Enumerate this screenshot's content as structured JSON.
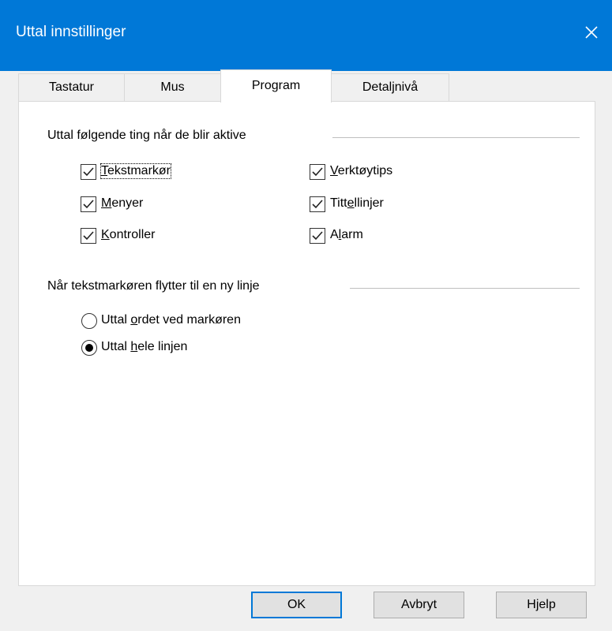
{
  "window": {
    "title": "Uttal innstillinger"
  },
  "tabs": [
    {
      "label": "Tastatur",
      "active": false
    },
    {
      "label": "Mus",
      "active": false
    },
    {
      "label": "Program",
      "active": true
    },
    {
      "label": "Detaljnivå",
      "active": false
    }
  ],
  "group1": {
    "label": "Uttal følgende ting når de blir aktive",
    "options": [
      {
        "label": "Tekstmarkør",
        "access_key": "T",
        "checked": true
      },
      {
        "label": "Menyer",
        "access_key": "M",
        "checked": true
      },
      {
        "label": "Kontroller",
        "access_key": "K",
        "checked": true
      },
      {
        "label": "Verktøytips",
        "access_key": "V",
        "checked": true
      },
      {
        "label": "Tittellinjer",
        "access_key": "e",
        "checked": true
      },
      {
        "label": "Alarm",
        "access_key": "l",
        "checked": true
      }
    ]
  },
  "group2": {
    "label": "Når tekstmarkøren flytter til en ny linje",
    "options": [
      {
        "label": "Uttal ordet ved markøren",
        "access_key": "o",
        "selected": false
      },
      {
        "label": "Uttal hele linjen",
        "access_key": "h",
        "selected": true
      }
    ]
  },
  "buttons": {
    "ok": "OK",
    "cancel": "Avbryt",
    "help": "Hjelp"
  },
  "colors": {
    "titlebar": "#0078d7",
    "dialog_bg": "#f0f0f0",
    "panel_bg": "#ffffff"
  }
}
